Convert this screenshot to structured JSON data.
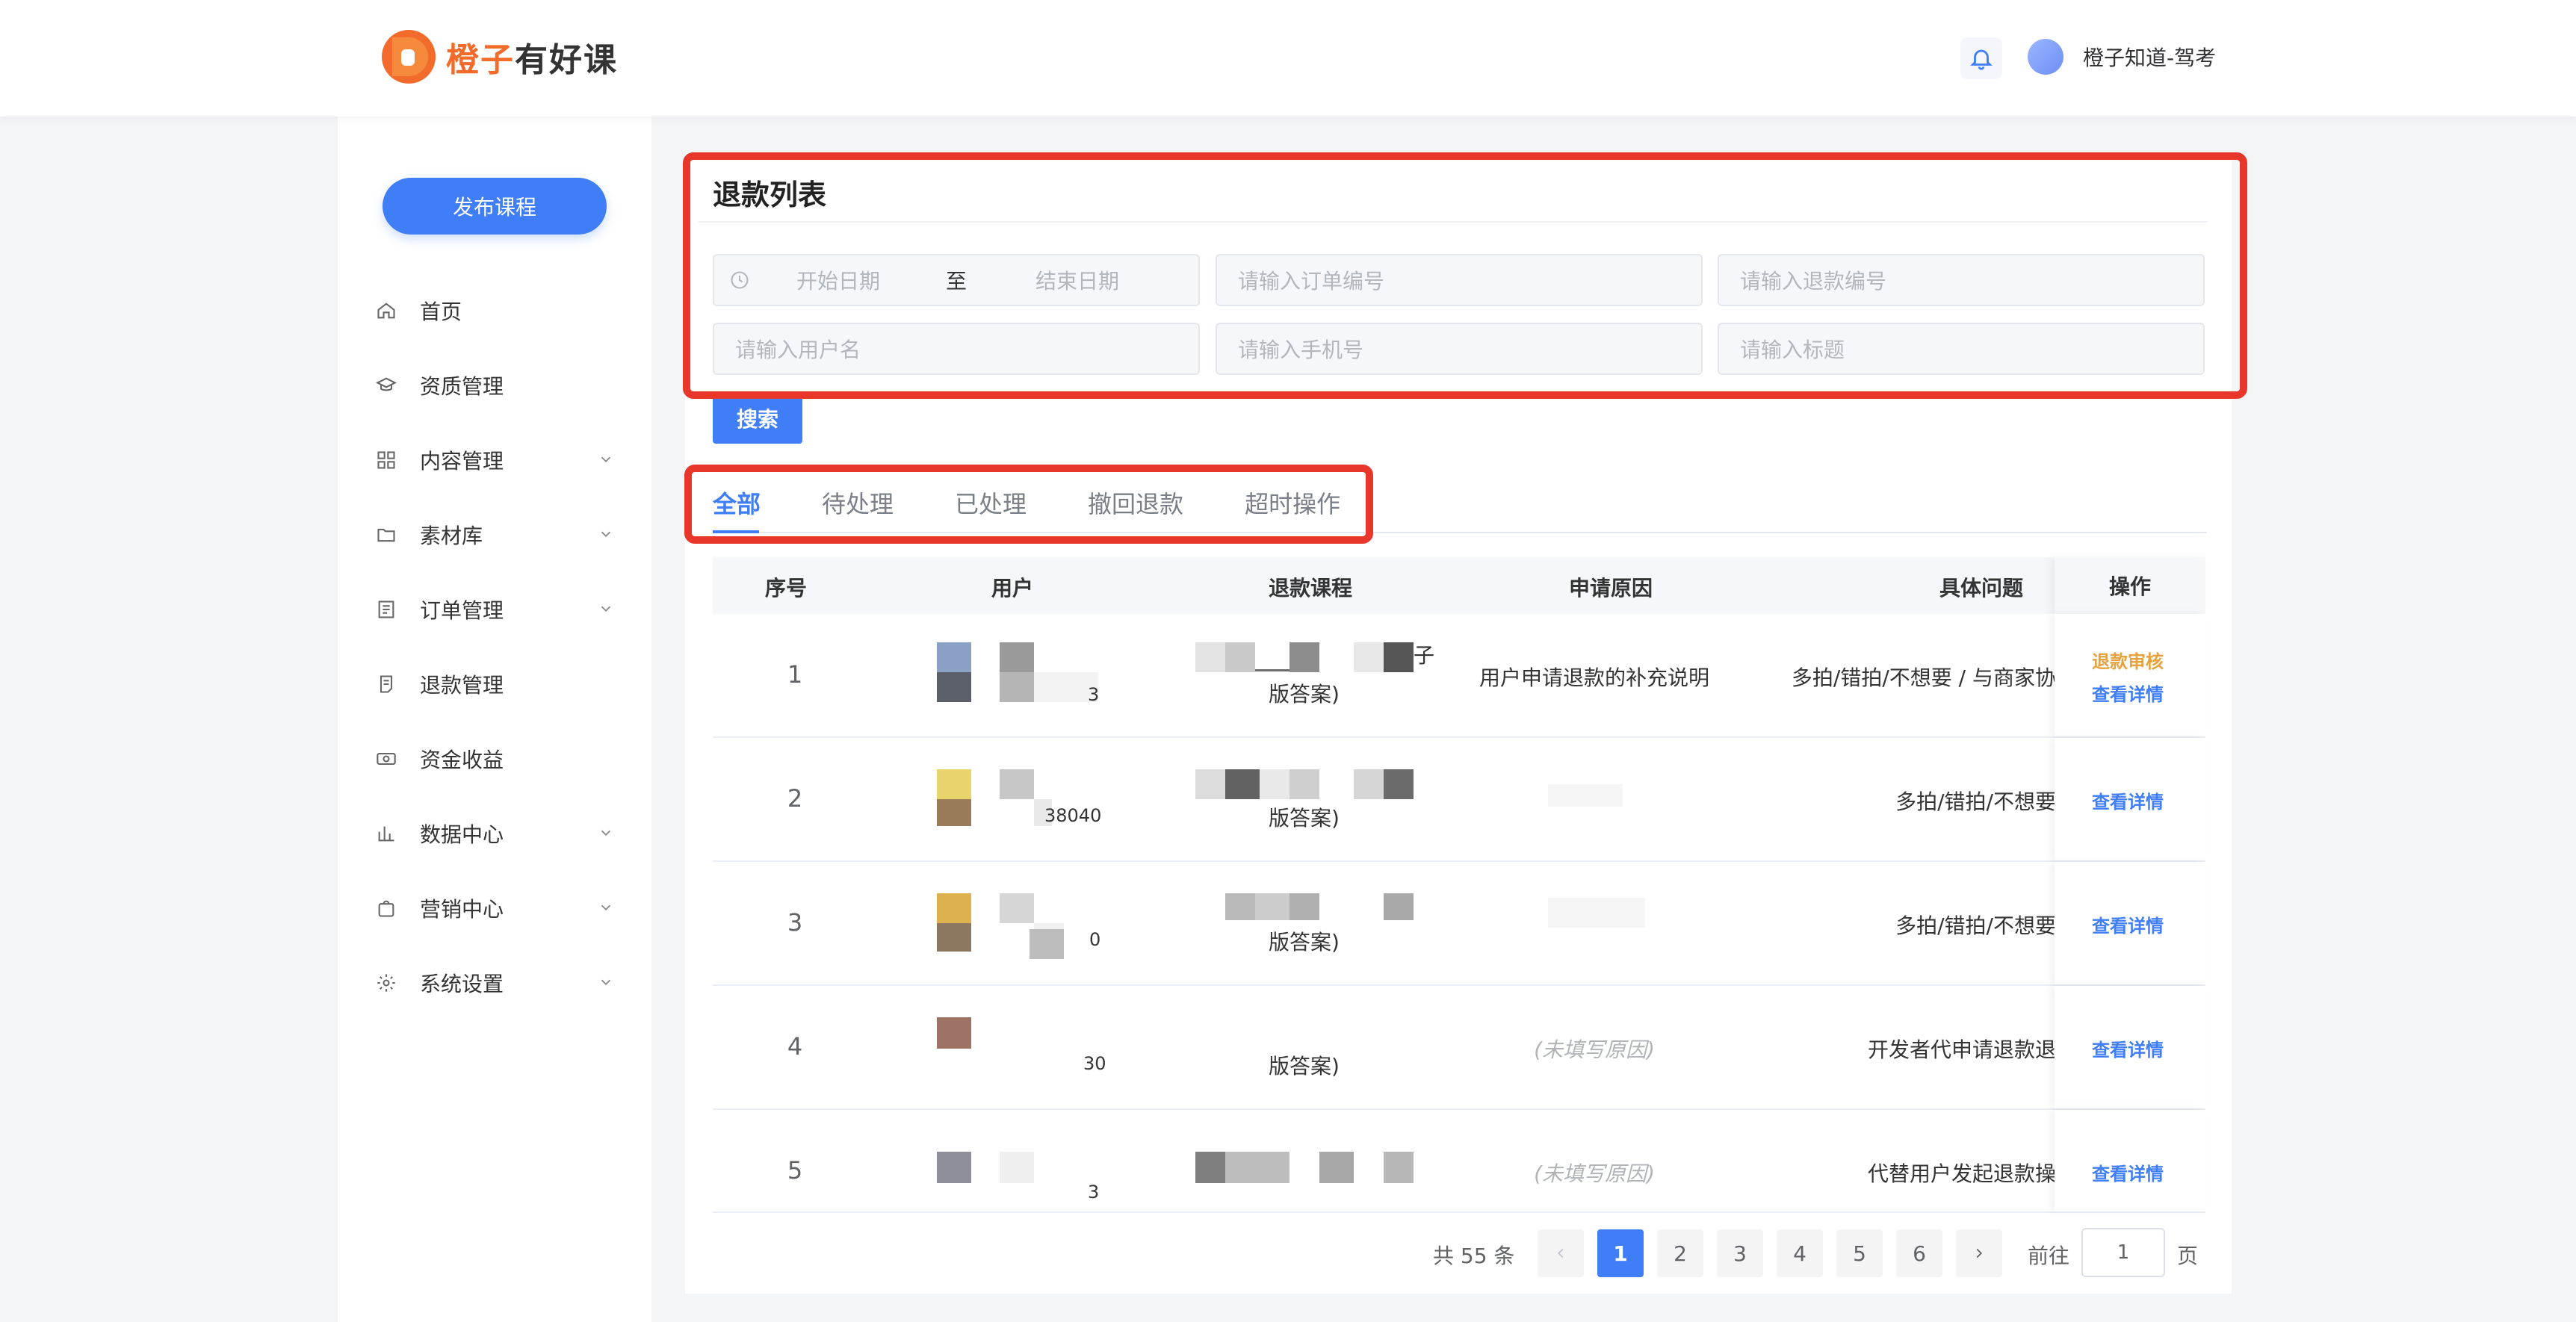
{
  "header": {
    "logo_text_orange": "橙子",
    "logo_text_dark": "有好课",
    "user_name": "橙子知道-驾考"
  },
  "sidebar": {
    "publish_label": "发布课程",
    "items": [
      {
        "label": "首页",
        "icon": "home-icon",
        "has_children": false
      },
      {
        "label": "资质管理",
        "icon": "graduation-cap-icon",
        "has_children": false
      },
      {
        "label": "内容管理",
        "icon": "grid-icon",
        "has_children": true
      },
      {
        "label": "素材库",
        "icon": "folder-icon",
        "has_children": true
      },
      {
        "label": "订单管理",
        "icon": "order-icon",
        "has_children": true
      },
      {
        "label": "退款管理",
        "icon": "refund-doc-icon",
        "has_children": false
      },
      {
        "label": "资金收益",
        "icon": "money-icon",
        "has_children": false
      },
      {
        "label": "数据中心",
        "icon": "bar-chart-icon",
        "has_children": true
      },
      {
        "label": "营销中心",
        "icon": "shopping-bag-icon",
        "has_children": true
      },
      {
        "label": "系统设置",
        "icon": "gear-icon",
        "has_children": true
      }
    ]
  },
  "main": {
    "title": "退款列表",
    "filters": {
      "start_date": "开始日期",
      "date_sep": "至",
      "end_date": "结束日期",
      "order_no": "请输入订单编号",
      "refund_no": "请输入退款编号",
      "username": "请输入用户名",
      "phone": "请输入手机号",
      "title": "请输入标题"
    },
    "search_label": "搜索",
    "tabs": [
      "全部",
      "待处理",
      "已处理",
      "撤回退款",
      "超时操作"
    ],
    "active_tab": 0,
    "table": {
      "columns": [
        "序号",
        "用户",
        "退款课程",
        "申请原因",
        "具体问题",
        "操作"
      ],
      "rows": [
        {
          "index": "1",
          "user_tail": "3",
          "course_tail": "版答案)",
          "course_extra": "子",
          "reason": "用户申请退款的补充说明",
          "reason_empty": false,
          "problem": "多拍/错拍/不想要 / 与商家协",
          "ops": [
            "退款审核",
            "查看详情"
          ]
        },
        {
          "index": "2",
          "user_tail": "38040",
          "course_tail": "版答案)",
          "course_extra": "",
          "reason": "",
          "reason_empty": false,
          "problem": "多拍/错拍/不想要",
          "ops": [
            "查看详情"
          ]
        },
        {
          "index": "3",
          "user_tail": "0",
          "course_tail": "版答案)",
          "course_extra": "",
          "reason": "",
          "reason_empty": false,
          "problem": "多拍/错拍/不想要",
          "ops": [
            "查看详情"
          ]
        },
        {
          "index": "4",
          "user_tail": "30",
          "course_tail": "版答案)",
          "course_extra": "",
          "reason": "(未填写原因)",
          "reason_empty": true,
          "problem": "开发者代申请退款退",
          "ops": [
            "查看详情"
          ]
        },
        {
          "index": "5",
          "user_tail": "3",
          "course_tail": "",
          "course_extra": "",
          "reason": "(未填写原因)",
          "reason_empty": true,
          "problem": "代替用户发起退款操",
          "ops": [
            "查看详情"
          ]
        }
      ]
    },
    "pagination": {
      "total_text": "共 55 条",
      "pages": [
        "1",
        "2",
        "3",
        "4",
        "5",
        "6"
      ],
      "current": "1",
      "goto_label": "前往",
      "goto_value": "1",
      "page_suffix": "页"
    }
  },
  "colors": {
    "primary": "#3f7ef7",
    "brand_orange": "#f26b2a",
    "audit": "#e6a23c",
    "annotation": "#e8372a"
  }
}
